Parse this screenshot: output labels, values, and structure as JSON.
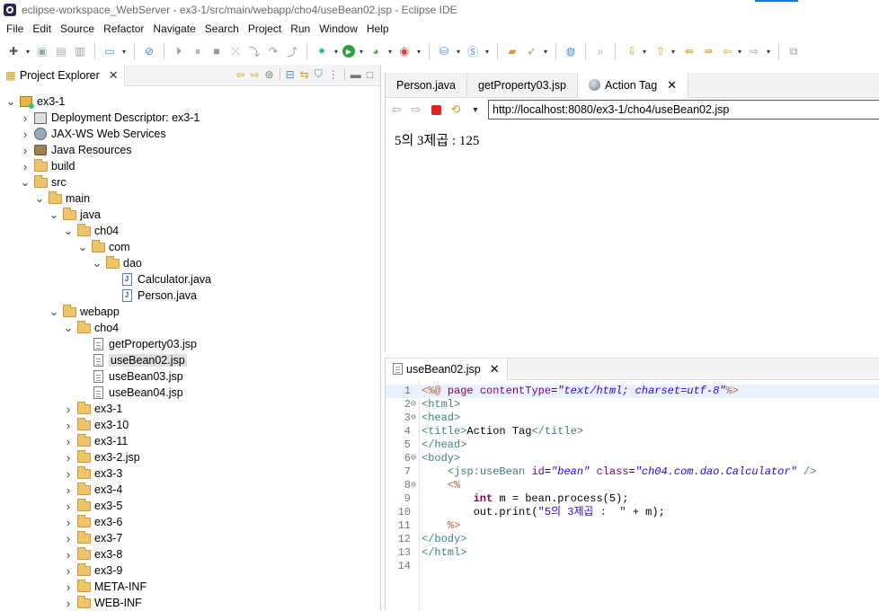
{
  "window": {
    "title": "eclipse-workspace_WebServer - ex3-1/src/main/webapp/cho4/useBean02.jsp - Eclipse IDE"
  },
  "menu": [
    "File",
    "Edit",
    "Source",
    "Refactor",
    "Navigate",
    "Search",
    "Project",
    "Run",
    "Window",
    "Help"
  ],
  "explorer": {
    "title": "Project Explorer",
    "tree": [
      {
        "label": "ex3-1",
        "depth": 0,
        "twisty": "open",
        "icon": "project"
      },
      {
        "label": "Deployment Descriptor: ex3-1",
        "depth": 1,
        "twisty": "closed",
        "icon": "descriptor"
      },
      {
        "label": "JAX-WS Web Services",
        "depth": 1,
        "twisty": "closed",
        "icon": "jaxws"
      },
      {
        "label": "Java Resources",
        "depth": 1,
        "twisty": "closed",
        "icon": "java-resources"
      },
      {
        "label": "build",
        "depth": 1,
        "twisty": "closed",
        "icon": "folder"
      },
      {
        "label": "src",
        "depth": 1,
        "twisty": "open",
        "icon": "folder"
      },
      {
        "label": "main",
        "depth": 2,
        "twisty": "open",
        "icon": "folder"
      },
      {
        "label": "java",
        "depth": 3,
        "twisty": "open",
        "icon": "folder"
      },
      {
        "label": "ch04",
        "depth": 4,
        "twisty": "open",
        "icon": "folder"
      },
      {
        "label": "com",
        "depth": 5,
        "twisty": "open",
        "icon": "folder"
      },
      {
        "label": "dao",
        "depth": 6,
        "twisty": "open",
        "icon": "folder"
      },
      {
        "label": "Calculator.java",
        "depth": 7,
        "twisty": "none",
        "icon": "java-file"
      },
      {
        "label": "Person.java",
        "depth": 7,
        "twisty": "none",
        "icon": "java-file"
      },
      {
        "label": "webapp",
        "depth": 3,
        "twisty": "open",
        "icon": "folder"
      },
      {
        "label": "cho4",
        "depth": 4,
        "twisty": "open",
        "icon": "folder"
      },
      {
        "label": "getProperty03.jsp",
        "depth": 5,
        "twisty": "none",
        "icon": "file"
      },
      {
        "label": "useBean02.jsp",
        "depth": 5,
        "twisty": "none",
        "icon": "file",
        "selected": true
      },
      {
        "label": "useBean03.jsp",
        "depth": 5,
        "twisty": "none",
        "icon": "file"
      },
      {
        "label": "useBean04.jsp",
        "depth": 5,
        "twisty": "none",
        "icon": "file"
      },
      {
        "label": "ex3-1",
        "depth": 4,
        "twisty": "closed",
        "icon": "folder"
      },
      {
        "label": "ex3-10",
        "depth": 4,
        "twisty": "closed",
        "icon": "folder"
      },
      {
        "label": "ex3-11",
        "depth": 4,
        "twisty": "closed",
        "icon": "folder"
      },
      {
        "label": "ex3-2.jsp",
        "depth": 4,
        "twisty": "closed",
        "icon": "folder"
      },
      {
        "label": "ex3-3",
        "depth": 4,
        "twisty": "closed",
        "icon": "folder"
      },
      {
        "label": "ex3-4",
        "depth": 4,
        "twisty": "closed",
        "icon": "folder"
      },
      {
        "label": "ex3-5",
        "depth": 4,
        "twisty": "closed",
        "icon": "folder"
      },
      {
        "label": "ex3-6",
        "depth": 4,
        "twisty": "closed",
        "icon": "folder"
      },
      {
        "label": "ex3-7",
        "depth": 4,
        "twisty": "closed",
        "icon": "folder"
      },
      {
        "label": "ex3-8",
        "depth": 4,
        "twisty": "closed",
        "icon": "folder"
      },
      {
        "label": "ex3-9",
        "depth": 4,
        "twisty": "closed",
        "icon": "folder"
      },
      {
        "label": "META-INF",
        "depth": 4,
        "twisty": "closed",
        "icon": "folder"
      },
      {
        "label": "WEB-INF",
        "depth": 4,
        "twisty": "closed",
        "icon": "folder"
      }
    ]
  },
  "browser": {
    "tabs": [
      {
        "label": "Person.java",
        "active": false
      },
      {
        "label": "getProperty03.jsp",
        "active": false
      },
      {
        "label": "Action Tag",
        "active": true
      }
    ],
    "url": "http://localhost:8080/ex3-1/cho4/useBean02.jsp",
    "content": "5의 3제곱 : 125"
  },
  "editor": {
    "tab": "useBean02.jsp",
    "lines": [
      {
        "n": "1",
        "fold": "",
        "html": "<span class='delim'>&lt;%@</span> <span class='dir'>page</span> <span class='attr'>contentType</span>=<span class='val'>\"text/html; charset=utf-8\"</span><span class='delim'>%&gt;</span>"
      },
      {
        "n": "2",
        "fold": "⊖",
        "html": "<span class='tag'>&lt;html&gt;</span>"
      },
      {
        "n": "3",
        "fold": "⊖",
        "html": "<span class='tag'>&lt;head&gt;</span>"
      },
      {
        "n": "4",
        "fold": "",
        "html": "<span class='tag'>&lt;title&gt;</span>Action Tag<span class='tag'>&lt;/title&gt;</span>"
      },
      {
        "n": "5",
        "fold": "",
        "html": "<span class='tag'>&lt;/head&gt;</span>"
      },
      {
        "n": "6",
        "fold": "⊖",
        "html": "<span class='tag'>&lt;body&gt;</span>"
      },
      {
        "n": "7",
        "fold": "",
        "html": "    <span class='tag'>&lt;jsp:useBean</span> <span class='attr'>id</span>=<span class='val'>\"bean\"</span> <span class='attr'>class</span>=<span class='val'>\"ch04.com.dao.Calculator\"</span> <span class='tag'>/&gt;</span>"
      },
      {
        "n": "8",
        "fold": "⊖",
        "html": "    <span class='delim'>&lt;%</span>"
      },
      {
        "n": "9",
        "fold": "",
        "html": "        <span class='kw'>int</span> m = bean.process(5);"
      },
      {
        "n": "10",
        "fold": "",
        "html": "        out.print(<span class='str'>\"5의 3제곱 :  \"</span> + m);"
      },
      {
        "n": "11",
        "fold": "",
        "html": "    <span class='delim'>%&gt;</span>"
      },
      {
        "n": "12",
        "fold": "",
        "html": "<span class='tag'>&lt;/body&gt;</span>"
      },
      {
        "n": "13",
        "fold": "",
        "html": "<span class='tag'>&lt;/html&gt;</span>"
      },
      {
        "n": "14",
        "fold": "",
        "html": ""
      }
    ]
  }
}
